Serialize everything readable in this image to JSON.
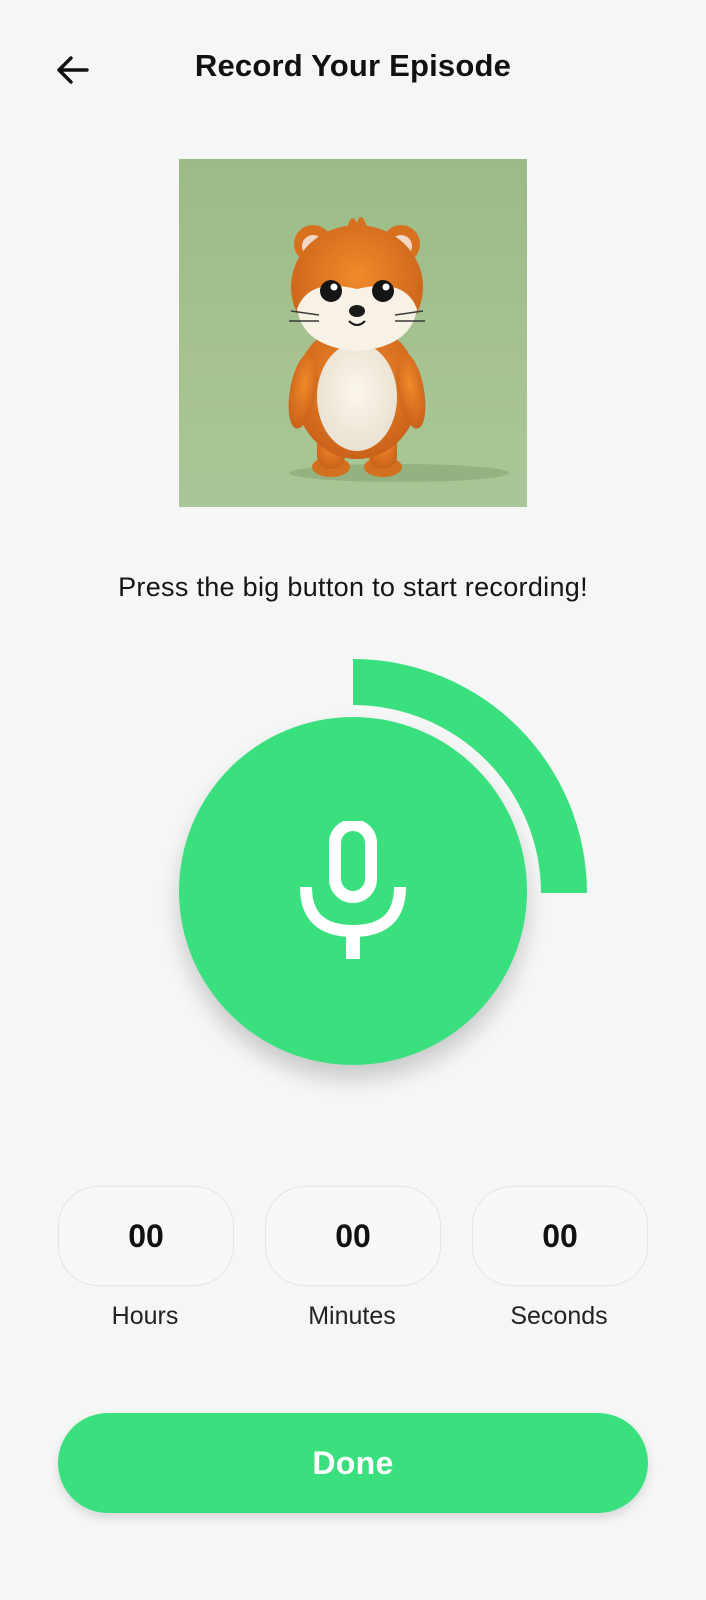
{
  "header": {
    "title": "Record Your Episode",
    "back_icon": "arrow-left-icon"
  },
  "artwork": {
    "subject": "cartoon orange hamster character",
    "background_color": "#9cbb87"
  },
  "instruction": "Press the big button to start recording!",
  "record": {
    "icon": "microphone-icon",
    "color": "#3ae07e",
    "progress_fraction": 0.25
  },
  "timer": {
    "hours": {
      "value": "00",
      "label": "Hours"
    },
    "minutes": {
      "value": "00",
      "label": "Minutes"
    },
    "seconds": {
      "value": "00",
      "label": "Seconds"
    }
  },
  "done_button": {
    "label": "Done",
    "color": "#3ae07e"
  }
}
